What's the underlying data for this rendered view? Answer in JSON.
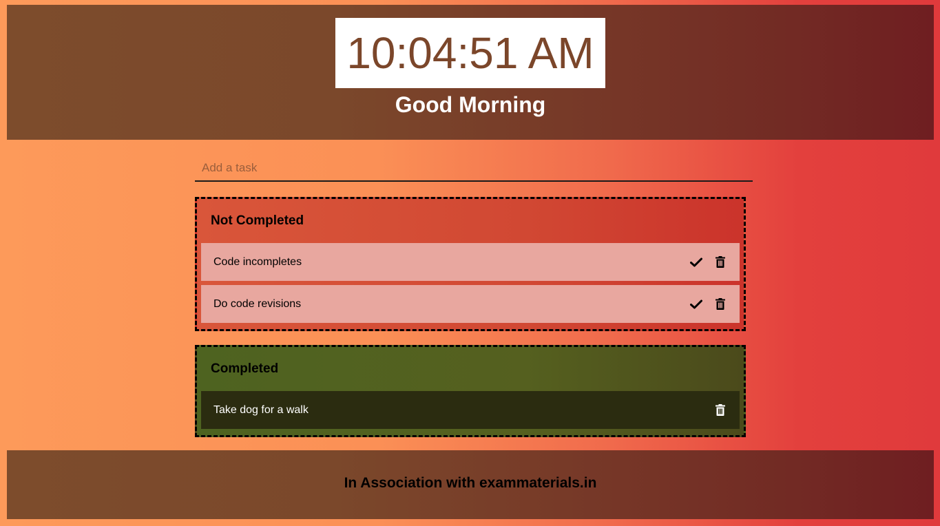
{
  "header": {
    "clock": "10:04:51 AM",
    "greeting": "Good Morning"
  },
  "task_input": {
    "placeholder": "Add a task",
    "value": ""
  },
  "not_completed": {
    "title": "Not Completed",
    "tasks": [
      {
        "text": "Code incompletes"
      },
      {
        "text": "Do code revisions"
      }
    ]
  },
  "completed": {
    "title": "Completed",
    "tasks": [
      {
        "text": "Take dog for a walk"
      }
    ]
  },
  "footer": {
    "text": "In Association with exammaterials.in"
  },
  "icons": {
    "complete": "check-icon",
    "delete": "trash-icon"
  },
  "colors": {
    "header_bg": "#7d4c2c",
    "clock_text": "#7b462a",
    "not_completed_bg": "#d14833",
    "not_completed_task_bg": "#e8a79f",
    "completed_bg": "#55601f",
    "completed_task_bg": "#2b2c10"
  }
}
